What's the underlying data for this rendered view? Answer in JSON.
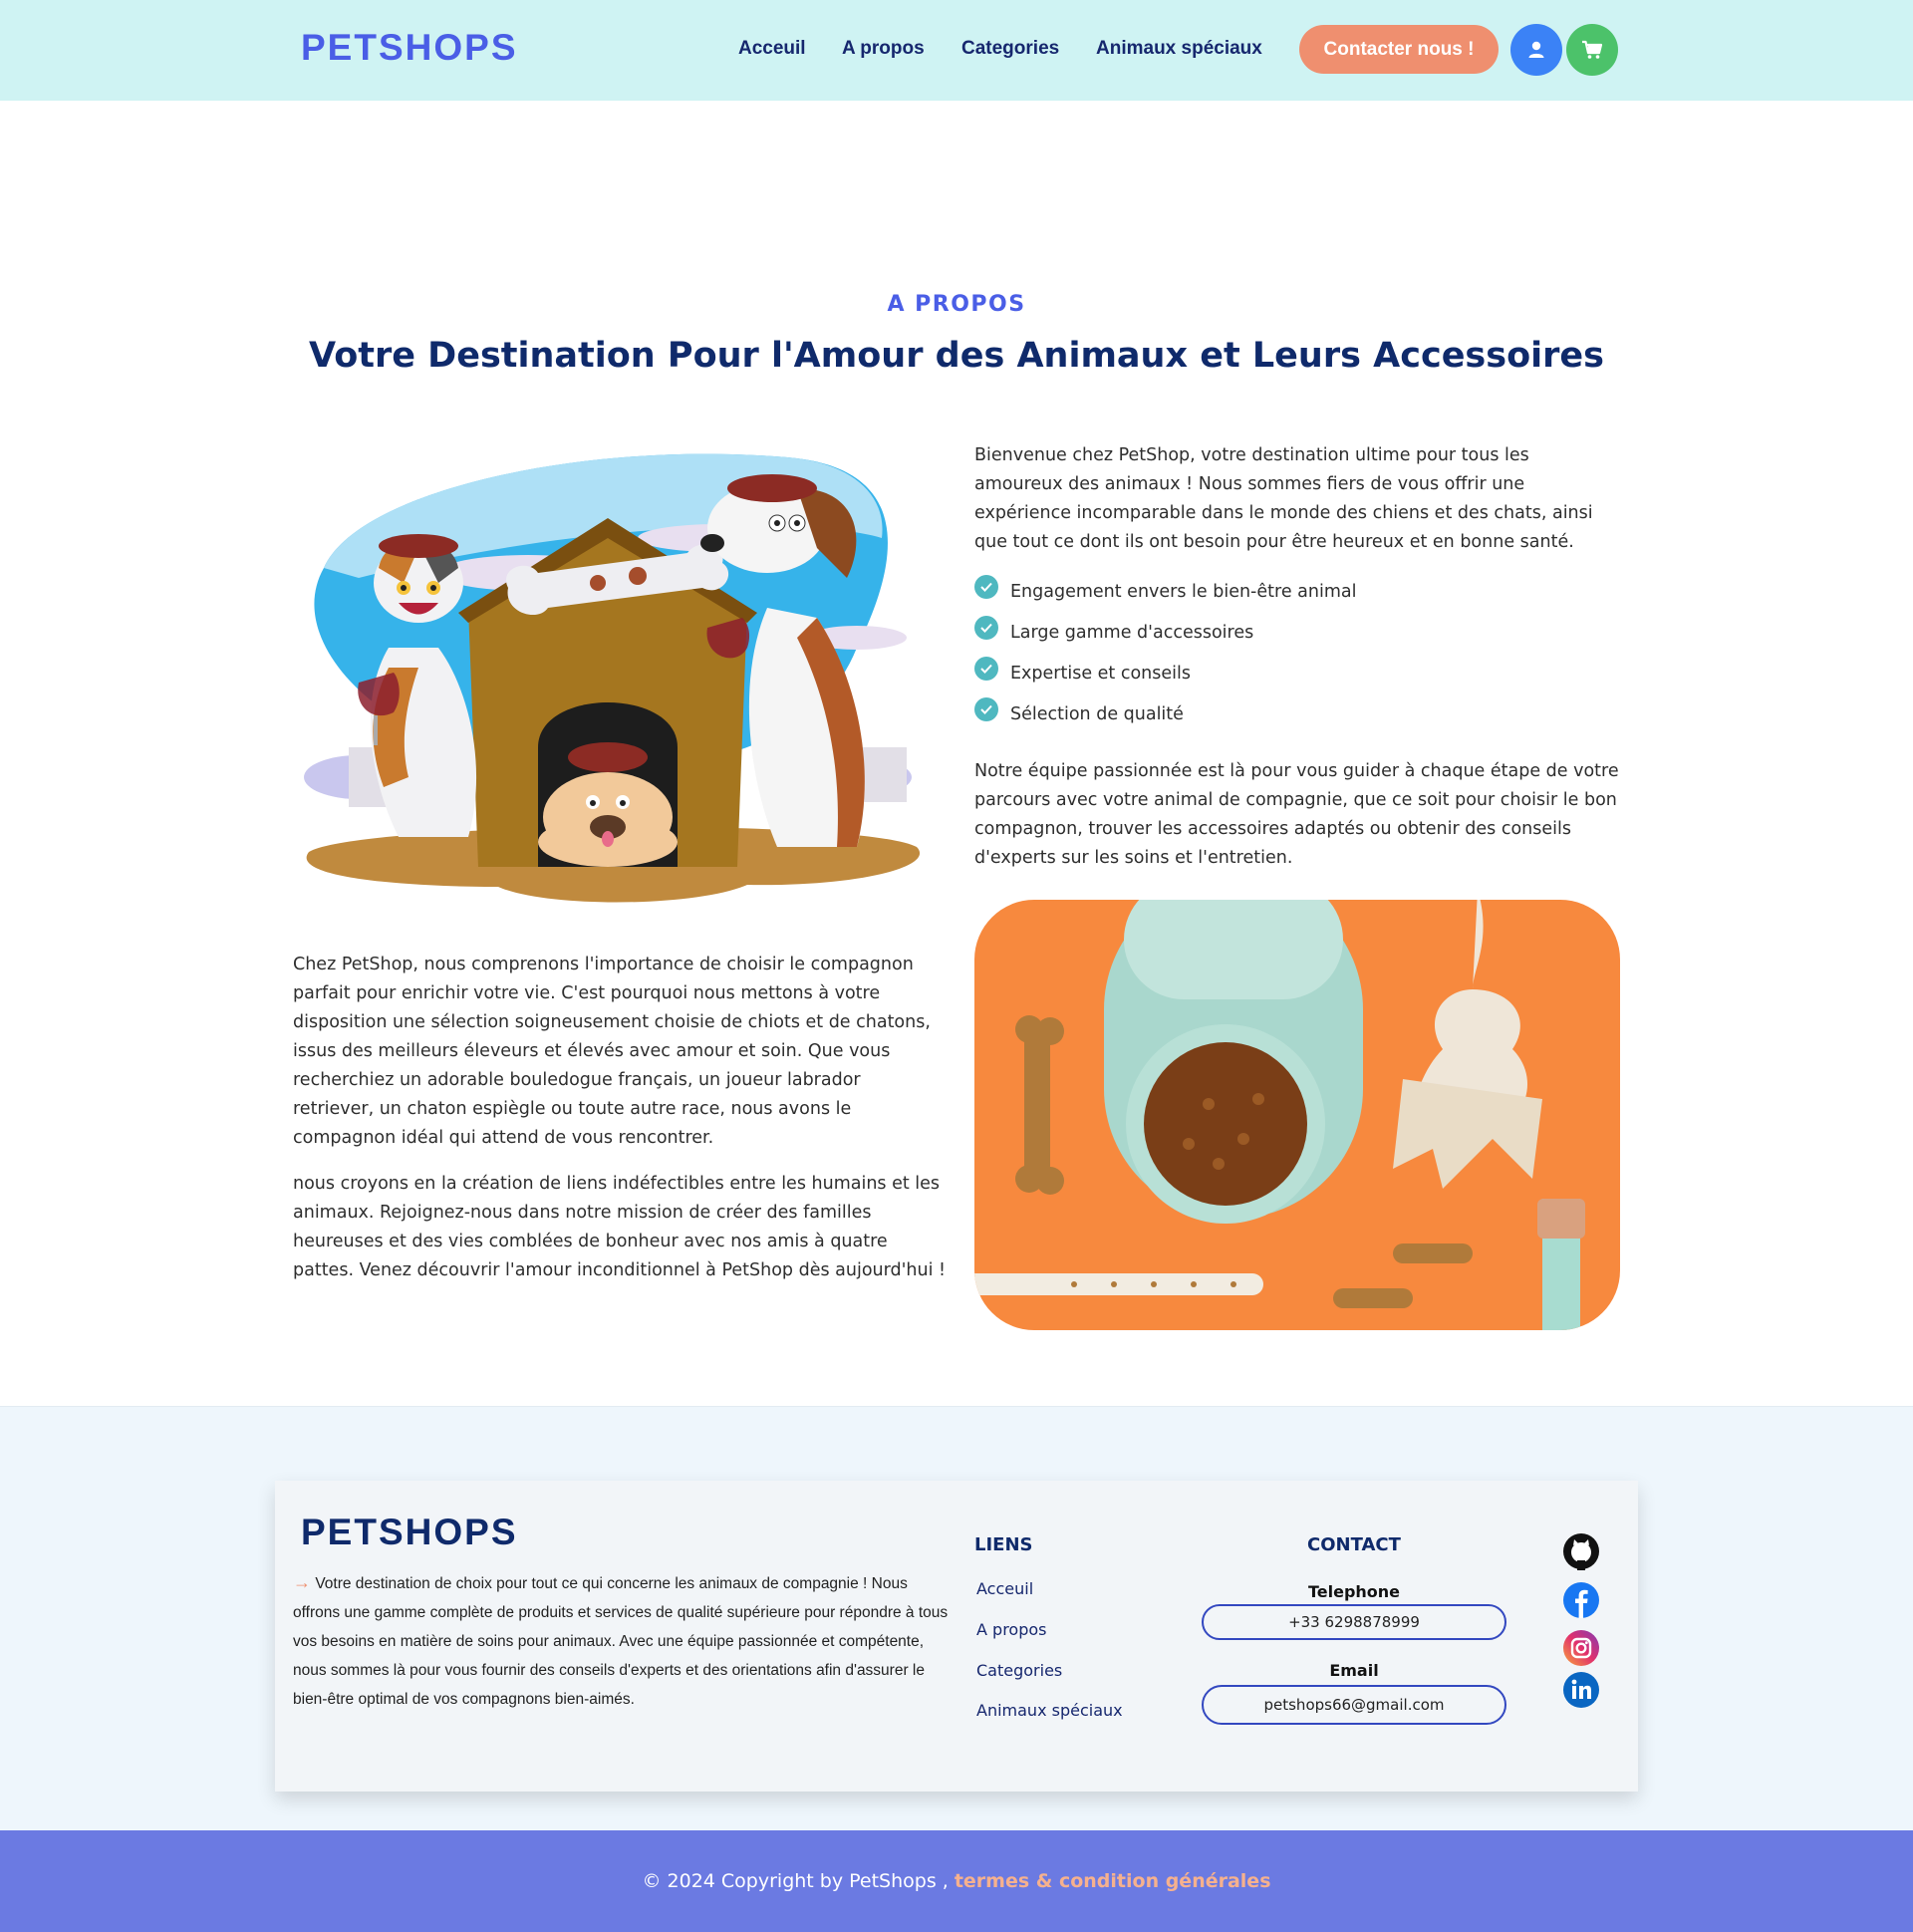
{
  "header": {
    "logo": "PETSHOPS",
    "nav": [
      "Acceuil",
      "A propos",
      "Categories",
      "Animaux spéciaux"
    ],
    "contact_button": "Contacter nous !",
    "user_icon": "user-icon",
    "cart_icon": "cart-icon",
    "colors": {
      "bg": "#cff3f3",
      "accent": "#4a5ee6",
      "contact": "#ef8f6f",
      "user": "#3b82f6",
      "cart": "#4cc26a"
    }
  },
  "about": {
    "label": "A PROPOS",
    "title": "Votre Destination Pour l'Amour des Animaux et Leurs Accessoires",
    "intro": "Bienvenue chez PetShop, votre destination ultime pour tous les amoureux des animaux ! Nous sommes fiers de vous offrir une expérience incomparable dans le monde des chiens et des chats, ainsi que tout ce dont ils ont besoin pour être heureux et en bonne santé.",
    "features": [
      "Engagement envers le bien-être animal",
      "Large gamme d'accessoires",
      "Expertise et conseils",
      "Sélection de qualité"
    ],
    "team": "Notre équipe passionnée est là pour vous guider à chaque étape de votre parcours avec votre animal de compagnie, que ce soit pour choisir le bon compagnon, trouver les accessoires adaptés ou obtenir des conseils d'experts sur les soins et l'entretien.",
    "para1": "Chez PetShop, nous comprenons l'importance de choisir le compagnon parfait pour enrichir votre vie. C'est pourquoi nous mettons à votre disposition une sélection soigneusement choisie de chiots et de chatons, issus des meilleurs éleveurs et élevés avec amour et soin. Que vous recherchiez un adorable bouledogue français, un joueur labrador retriever, un chaton espiègle ou toute autre race, nous avons le compagnon idéal qui attend de vous rencontrer.",
    "para2": "nous croyons en la création de liens indéfectibles entre les humains et les animaux. Rejoignez-nous dans notre mission de créer des familles heureuses et des vies comblées de bonheur avec nos amis à quatre pattes. Venez découvrir l'amour inconditionnel à PetShop dès aujourd'hui !"
  },
  "footer": {
    "logo": "PETSHOPS",
    "description": "Votre destination de choix pour tout ce qui concerne les animaux de compagnie ! Nous offrons une gamme complète de produits et services de qualité supérieure pour répondre à tous vos besoins en matière de soins pour animaux. Avec une équipe passionnée et compétente, nous sommes là pour vous fournir des conseils d'experts et des orientations afin d'assurer le bien-être optimal de vos compagnons bien-aimés.",
    "links_heading": "LIENS",
    "links": [
      "Acceuil",
      "A propos",
      "Categories",
      "Animaux spéciaux"
    ],
    "contact_heading": "CONTACT",
    "phone_label": "Telephone",
    "phone": "+33 6298878999",
    "email_label": "Email",
    "email": "petshops66@gmail.com",
    "socials": [
      "github-icon",
      "facebook-icon",
      "instagram-icon",
      "linkedin-icon"
    ],
    "copyright": "© 2024 Copyright by PetShops ,",
    "terms": "termes & condition générales"
  }
}
